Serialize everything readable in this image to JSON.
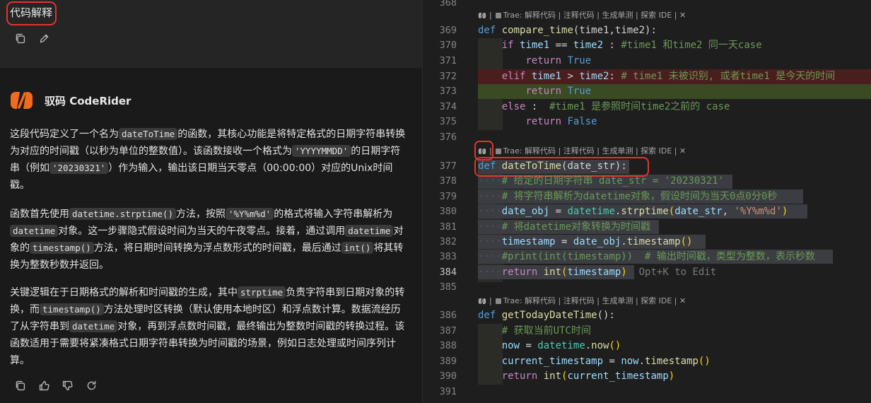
{
  "chat": {
    "user_message": "代码解释",
    "bot_name": "驭码 CodeRider",
    "p1": {
      "a": "这段代码定义了一个名为",
      "c1": "dateToTime",
      "b": "的函数，其核心功能是将特定格式的日期字符串转换为对应的时间戳（以秒为单位的整数值）。该函数接收一个格式为",
      "c2": "'YYYYMMDD'",
      "d": "的日期字符串（例如",
      "c3": "'20230321'",
      "e": "）作为输入，输出该日期当天零点（00:00:00）对应的Unix时间戳。"
    },
    "p2": {
      "a": "函数首先使用",
      "c1": "datetime.strptime()",
      "b": "方法，按照",
      "c2": "'%Y%m%d'",
      "d": "的格式将输入字符串解析为",
      "c3": "datetime",
      "e": "对象。这一步骤隐式假设时间为当天的午夜零点。接着，通过调用",
      "c4": "datetime",
      "f": "对象的",
      "c5": "timestamp()",
      "g": "方法，将日期时间转换为浮点数形式的时间戳，最后通过",
      "c6": "int()",
      "h": "将其转换为整数秒数并返回。"
    },
    "p3": {
      "a": "关键逻辑在于日期格式的解析和时间戳的生成，其中",
      "c1": "strptime",
      "b": "负责字符串到日期对象的转换，而",
      "c2": "timestamp()",
      "d": "方法处理时区转换（默认使用本地时区）和浮点数计算。数据流经历了从字符串到",
      "c3": "datetime",
      "e": "对象，再到浮点数时间戳，最终输出为整数时间戳的转换过程。该函数适用于需要将紧凑格式日期字符串转换为时间戳的场景，例如日志处理或时间序列计算。"
    }
  },
  "editor": {
    "code_lens_text": "Trae: 解释代码 | 注释代码 | 生成单测 | 探索 IDE | ✕",
    "line_numbers": [
      "368",
      "369",
      "370",
      "371",
      "372",
      "373",
      "374",
      "375",
      "376",
      "377",
      "378",
      "379",
      "380",
      "381",
      "382",
      "383",
      "384",
      "385",
      "386",
      "387",
      "388",
      "389",
      "390",
      "391"
    ],
    "active_line": "384",
    "inline_hint": "Opt+K to Edit",
    "lines": {
      "l369": {
        "kw": "def",
        "fn": "compare_time",
        "args": "(time1,time2):"
      },
      "l370": {
        "kw": "if",
        "a": "time1",
        "op": " == ",
        "b": "time2",
        "rest": " : ",
        "cmt": "#time1 和time2 同一天case"
      },
      "l371": {
        "kw": "return",
        "val": "True"
      },
      "l372": {
        "kw": "elif",
        "a": "time1",
        "op": " > ",
        "b": "time2",
        "rest": ": ",
        "cmt": "# time1 未被识别, 或者time1 是今天的时间"
      },
      "l373": {
        "kw": "return",
        "val": "True"
      },
      "l374": {
        "kw": "else",
        "rest": " :  ",
        "cmt": "#time1 是参照时间time2之前的 case"
      },
      "l375": {
        "kw": "return",
        "val": "False"
      },
      "l377": {
        "kw": "def",
        "fn": "dateToTime",
        "args": "(date_str):"
      },
      "l378": {
        "cmt": "# 给定的日期字符串 date_str = '20230321'"
      },
      "l379": {
        "cmt": "# 将字符串解析为datetime对象，假设时间为当天0点0分0秒"
      },
      "l380": {
        "a": "date_obj",
        "op": " = ",
        "mod": "datetime",
        "fn": ".strptime",
        "open": "(",
        "arg": "date_str",
        "comma": ", ",
        "str": "'%Y%m%d'",
        "close": ")"
      },
      "l381": {
        "cmt": "# 将datetime对象转换为时间戳"
      },
      "l382": {
        "a": "timestamp",
        "op": " = ",
        "b": "date_obj",
        "fn": ".timestamp",
        "paren": "()"
      },
      "l383": {
        "cmt": "#print(int(timestamp))  # 输出时间戳，类型为整数，表示秒数"
      },
      "l384": {
        "kw": "return",
        "fn": "int",
        "open": "(",
        "a": "timestamp",
        "close": ")"
      },
      "l386": {
        "kw": "def",
        "fn": "getTodayDateTime",
        "args": "():"
      },
      "l387": {
        "cmt": "# 获取当前UTC时间"
      },
      "l388": {
        "a": "now",
        "op": " = ",
        "mod": "datetime",
        "fn": ".now",
        "paren": "()"
      },
      "l389": {
        "a": "current_timestamp",
        "op": " = ",
        "b": "now",
        "fn": ".timestamp",
        "paren": "()"
      },
      "l390": {
        "kw": "return",
        "fn": "int",
        "open": "(",
        "a": "current_timestamp",
        "close": ")"
      }
    }
  },
  "colors": {
    "highlight_red": "#e0352b",
    "brand_orange": "#f26b1d"
  }
}
